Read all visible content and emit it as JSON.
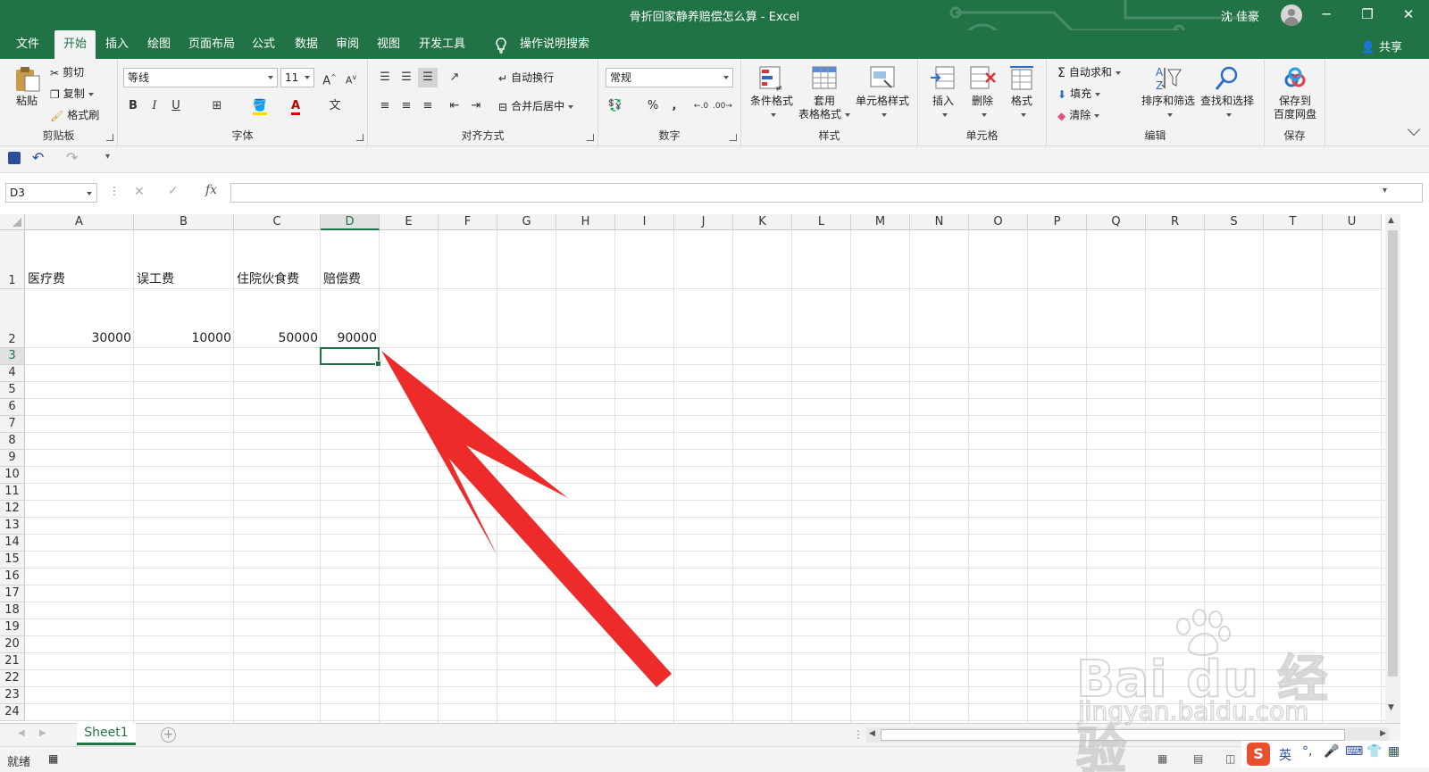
{
  "window": {
    "title": "骨折回家静养赔偿怎么算 - Excel",
    "user": "沈 佳豪",
    "share_label": "共享"
  },
  "menu_tabs": [
    "文件",
    "开始",
    "插入",
    "绘图",
    "页面布局",
    "公式",
    "数据",
    "审阅",
    "视图",
    "开发工具",
    "操作说明搜索"
  ],
  "active_tab": "开始",
  "ribbon": {
    "clipboard": {
      "paste": "粘贴",
      "cut": "剪切",
      "copy": "复制",
      "format_painter": "格式刷",
      "label": "剪贴板"
    },
    "font": {
      "name": "等线",
      "size": "11",
      "label": "字体",
      "bold": "B",
      "italic": "I",
      "underline": "U",
      "grow": "A",
      "shrink": "A",
      "color_a": "A",
      "wen": "文"
    },
    "alignment": {
      "wrap": "自动换行",
      "merge": "合并后居中",
      "label": "对齐方式"
    },
    "number": {
      "format": "常规",
      "percent": "%",
      "comma": ",",
      "label": "数字"
    },
    "styles": {
      "conditional": "条件格式",
      "table_line1": "套用",
      "table_line2": "表格格式",
      "cell_styles": "单元格样式",
      "label": "样式"
    },
    "cells": {
      "insert": "插入",
      "delete": "删除",
      "format": "格式",
      "label": "单元格"
    },
    "editing": {
      "autosum": "自动求和",
      "fill": "填充",
      "clear": "清除",
      "sort": "排序和筛选",
      "find": "查找和选择",
      "label": "编辑"
    },
    "save": {
      "line1": "保存到",
      "line2": "百度网盘",
      "label": "保存"
    }
  },
  "formula_bar": {
    "name_box": "D3",
    "fx": "fx",
    "formula": "",
    "cancel": "✕",
    "enter": "✓"
  },
  "columns": [
    "A",
    "B",
    "C",
    "D",
    "E",
    "F",
    "G",
    "H",
    "I",
    "J",
    "K",
    "L",
    "M",
    "N",
    "O",
    "P",
    "Q",
    "R",
    "S",
    "T",
    "U"
  ],
  "rows": [
    "1",
    "2",
    "3",
    "4",
    "5",
    "6",
    "7",
    "8",
    "9",
    "10",
    "11",
    "12",
    "13",
    "14",
    "15",
    "16",
    "17",
    "18",
    "19",
    "20",
    "21",
    "22",
    "23",
    "24"
  ],
  "cells": {
    "A1": "医疗费",
    "B1": "误工费",
    "C1": "住院伙食费",
    "D1": "赔偿费",
    "A2": "30000",
    "B2": "10000",
    "C2": "50000",
    "D2": "90000"
  },
  "sheet_tabs": [
    "Sheet1"
  ],
  "status": "就绪",
  "ime": {
    "lang": "英"
  },
  "watermark": {
    "logo": "Bai du 经验",
    "url": "jingyan.baidu.com"
  },
  "colors": {
    "brand": "#217346",
    "arrow": "#ee2b2b"
  }
}
